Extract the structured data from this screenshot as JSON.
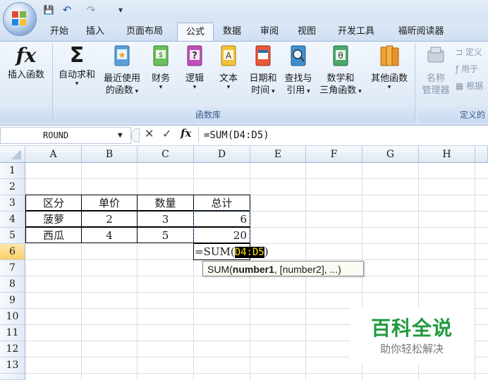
{
  "quick_access": {
    "save": "💾",
    "undo": "↶",
    "redo": "↷",
    "customize": "▾"
  },
  "tabs": [
    "开始",
    "插入",
    "页面布局",
    "公式",
    "数据",
    "审阅",
    "视图",
    "开发工具",
    "福昕阅读器"
  ],
  "active_tab": "公式",
  "ribbon": {
    "insert_function": "插入函数",
    "autosum": "自动求和",
    "recent_1": "最近使用",
    "recent_2": "的函数",
    "financial": "财务",
    "logical": "逻辑",
    "text": "文本",
    "datetime_1": "日期和",
    "datetime_2": "时间",
    "lookup_1": "查找与",
    "lookup_2": "引用",
    "math_1": "数学和",
    "math_2": "三角函数",
    "other": "其他函数",
    "name_mgr_1": "名称",
    "name_mgr_2": "管理器",
    "define_name": "定义",
    "use_in_formula": "用于",
    "create_from_sel": "根据",
    "group_library": "函数库",
    "group_defined": "定义的"
  },
  "formula_bar": {
    "name_box": "ROUND",
    "fx": "fx",
    "formula": "=SUM(D4:D5)"
  },
  "columns": [
    "A",
    "B",
    "C",
    "D",
    "E",
    "F",
    "G",
    "H"
  ],
  "rows": [
    "1",
    "2",
    "3",
    "4",
    "5",
    "6",
    "7",
    "8",
    "9",
    "10",
    "11",
    "12",
    "13"
  ],
  "table": {
    "headers": [
      "区分",
      "单价",
      "数量",
      "总计"
    ],
    "row4": [
      "菠萝",
      "2",
      "3",
      "6"
    ],
    "row5": [
      "西瓜",
      "4",
      "5",
      "20"
    ]
  },
  "editing_cell": {
    "prefix": "=SUM(",
    "range": "D4:D5",
    "suffix": ")"
  },
  "tooltip": {
    "fn": "SUM(",
    "arg1": "number1",
    "rest": ", [number2], ...)"
  },
  "watermark": {
    "title": "百科全说",
    "subtitle": "助你轻松解决"
  },
  "colors": {
    "accent": "#1e9a3e",
    "ribbon_bg": "#dfe9f6",
    "selection": "#f8cf6a"
  }
}
